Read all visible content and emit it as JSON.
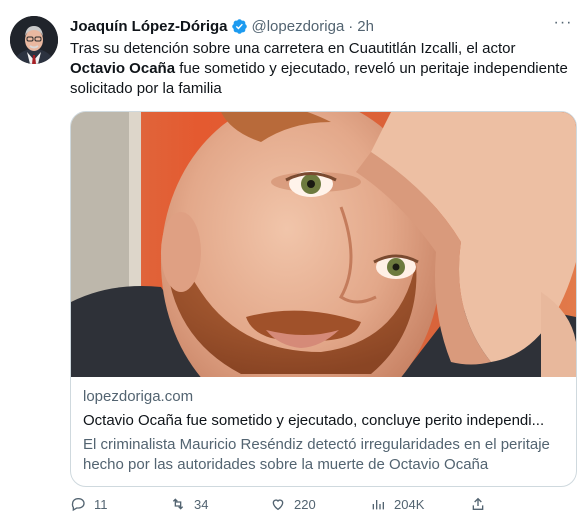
{
  "tweet": {
    "author_name": "Joaquín López-Dóriga",
    "handle": "@lopezdoriga",
    "separator": "·",
    "time": "2h",
    "more_label": "···",
    "text_part1": "Tras su detención sobre una carretera en Cuautitlán Izcalli, el actor ",
    "text_bold": "Octavio Ocaña",
    "text_part2": " fue sometido y ejecutado, reveló un peritaje independiente solicitado por la familia"
  },
  "card": {
    "domain": "lopezdoriga.com",
    "title": "Octavio Ocaña fue sometido y ejecutado, concluye perito independi...",
    "description": "El criminalista Mauricio Reséndiz detectó irregularidades en el peritaje hecho por las autoridades sobre la muerte de Octavio Ocaña"
  },
  "actions": {
    "reply_count": "11",
    "retweet_count": "34",
    "like_count": "220",
    "views_count": "204K"
  },
  "colors": {
    "verified": "#1d9bf0",
    "secondary_text": "#536471",
    "border": "#cfd9de"
  },
  "icons": [
    "verified-badge-icon",
    "more-icon",
    "reply-icon",
    "retweet-icon",
    "like-icon",
    "views-icon",
    "share-icon"
  ]
}
